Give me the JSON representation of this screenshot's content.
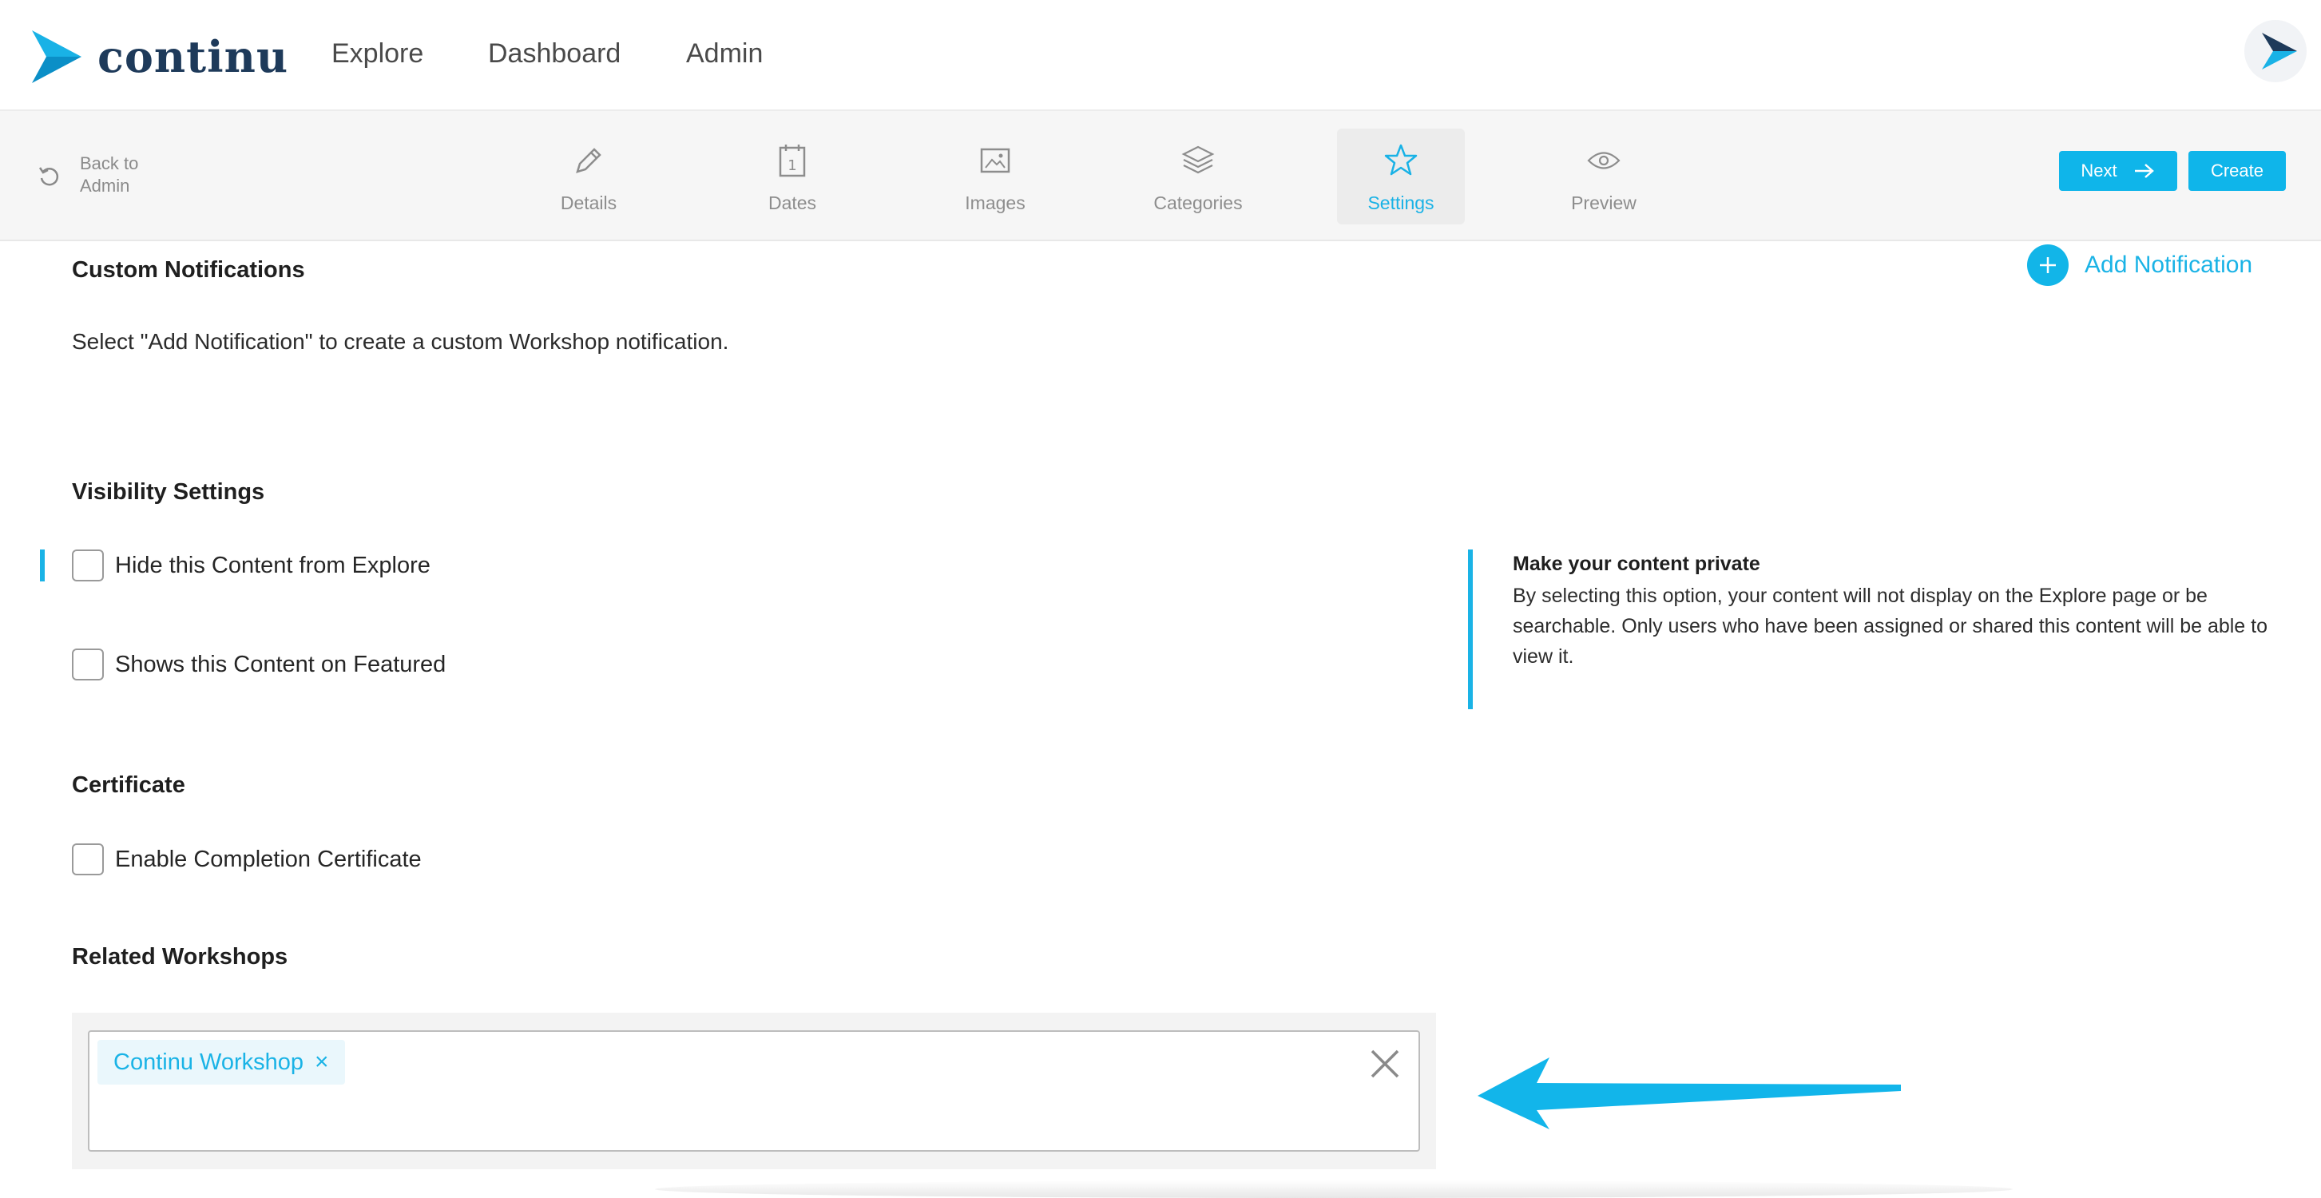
{
  "nav": {
    "brand": "continu",
    "links": [
      "Explore",
      "Dashboard",
      "Admin"
    ]
  },
  "stepbar": {
    "back_label": "Back to Admin",
    "steps": [
      {
        "label": "Details",
        "icon": "pencil-icon"
      },
      {
        "label": "Dates",
        "icon": "calendar-icon"
      },
      {
        "label": "Images",
        "icon": "image-icon"
      },
      {
        "label": "Categories",
        "icon": "layers-icon"
      },
      {
        "label": "Settings",
        "icon": "star-icon",
        "active": true
      },
      {
        "label": "Preview",
        "icon": "eye-icon"
      }
    ],
    "next_label": "Next",
    "create_label": "Create"
  },
  "notifications": {
    "heading": "Custom Notifications",
    "add_label": "Add Notification",
    "helper": "Select \"Add Notification\" to create a custom Workshop notification."
  },
  "visibility": {
    "heading": "Visibility Settings",
    "options": [
      {
        "label": "Hide this Content from Explore",
        "checked": false
      },
      {
        "label": "Shows this Content on Featured",
        "checked": false
      }
    ],
    "info_title": "Make your content private",
    "info_text": "By selecting this option, your content will not display on the Explore page or be searchable. Only users who have been assigned or shared this content will be able to view it."
  },
  "certificate": {
    "heading": "Certificate",
    "option": {
      "label": "Enable Completion Certificate",
      "checked": false
    }
  },
  "related": {
    "heading": "Related Workshops",
    "tags": [
      "Continu Workshop"
    ]
  },
  "colors": {
    "accent": "#1AB3E6",
    "brand_dark": "#1E3A5A",
    "button": "#0FB5EA"
  }
}
